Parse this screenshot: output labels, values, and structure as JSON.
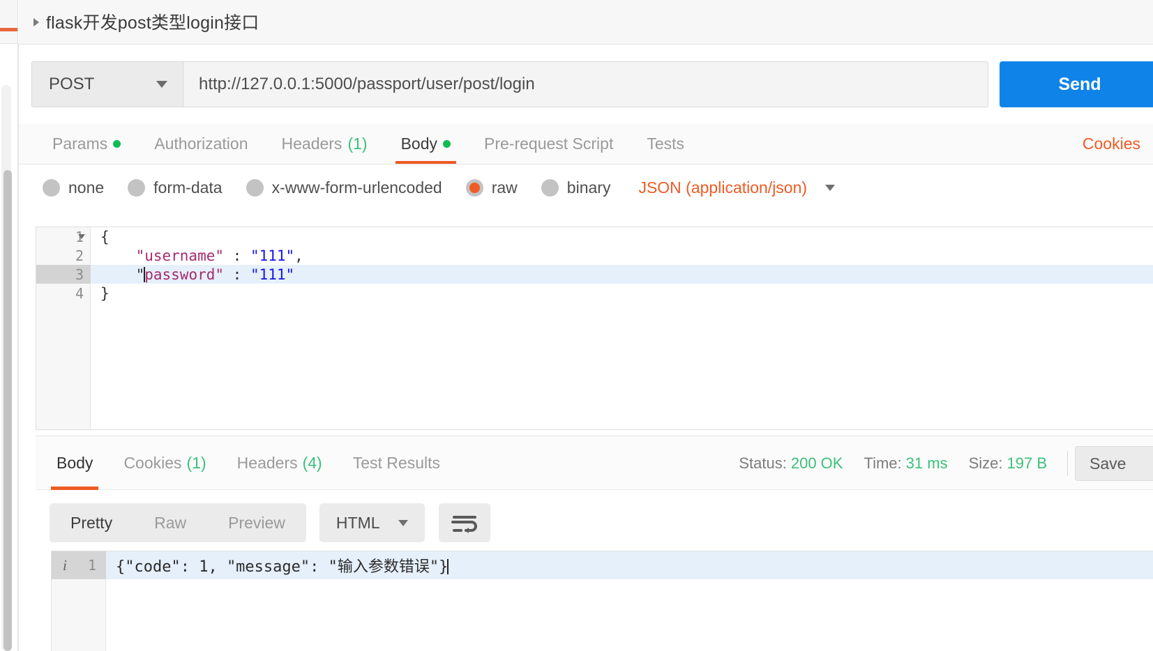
{
  "request": {
    "title": "flask开发post类型login接口",
    "method": "POST",
    "url": "http://127.0.0.1:5000/passport/user/post/login",
    "send_label": "Send",
    "tabs": [
      {
        "label": "Params",
        "badge_dot": true,
        "count": "",
        "active": false
      },
      {
        "label": "Authorization",
        "badge_dot": false,
        "count": "",
        "active": false
      },
      {
        "label": "Headers",
        "badge_dot": false,
        "count": "(1)",
        "active": false
      },
      {
        "label": "Body",
        "badge_dot": true,
        "count": "",
        "active": true
      },
      {
        "label": "Pre-request Script",
        "badge_dot": false,
        "count": "",
        "active": false
      },
      {
        "label": "Tests",
        "badge_dot": false,
        "count": "",
        "active": false
      }
    ],
    "cookies_link": "Cookies",
    "body_types": [
      {
        "label": "none",
        "selected": false
      },
      {
        "label": "form-data",
        "selected": false
      },
      {
        "label": "x-www-form-urlencoded",
        "selected": false
      },
      {
        "label": "raw",
        "selected": true
      },
      {
        "label": "binary",
        "selected": false
      }
    ],
    "content_type": "JSON (application/json)",
    "body_lines": [
      {
        "num": "1",
        "fold": true,
        "highlight": false,
        "text": "{"
      },
      {
        "num": "2",
        "fold": false,
        "highlight": false,
        "key": "\"username\"",
        "sep": " : ",
        "val": "\"111\"",
        "tail": ","
      },
      {
        "num": "3",
        "fold": false,
        "highlight": true,
        "key": "\"password\"",
        "sep": " : ",
        "val": "\"111\"",
        "tail": ""
      },
      {
        "num": "4",
        "fold": false,
        "highlight": false,
        "text": "}"
      }
    ]
  },
  "response": {
    "tabs": [
      {
        "label": "Body",
        "count": "",
        "active": true
      },
      {
        "label": "Cookies",
        "count": "(1)",
        "active": false
      },
      {
        "label": "Headers",
        "count": "(4)",
        "active": false
      },
      {
        "label": "Test Results",
        "count": "",
        "active": false
      }
    ],
    "status_label": "Status:",
    "status_value": "200 OK",
    "time_label": "Time:",
    "time_value": "31 ms",
    "size_label": "Size:",
    "size_value": "197 B",
    "save_label": "Save",
    "view_modes": [
      {
        "label": "Pretty",
        "active": true
      },
      {
        "label": "Raw",
        "active": false
      },
      {
        "label": "Preview",
        "active": false
      }
    ],
    "format": "HTML",
    "body_line_number": "1",
    "body_text": "{\"code\": 1, \"message\": \"输入参数错误\"}"
  },
  "colors": {
    "accent_orange": "#ef5b25",
    "send_blue": "#0f83e8",
    "status_green": "#3cc07a",
    "dot_green": "#0cbb52",
    "json_key": "#a52b6d",
    "json_string": "#1515ee",
    "highlight_line": "#e6f0fb"
  }
}
